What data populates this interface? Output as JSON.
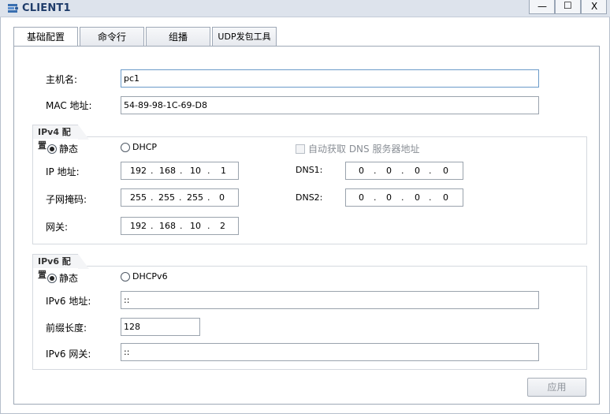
{
  "window": {
    "title": "CLIENT1",
    "min_glyph": "—",
    "max_glyph": "☐",
    "close_glyph": "X"
  },
  "tabs": [
    {
      "label": "基础配置",
      "active": true
    },
    {
      "label": "命令行",
      "active": false
    },
    {
      "label": "组播",
      "active": false
    },
    {
      "label": "UDP发包工具",
      "active": false
    }
  ],
  "basic": {
    "hostname_label": "主机名:",
    "hostname_value": "pc1",
    "mac_label": "MAC 地址:",
    "mac_value": "54-89-98-1C-69-D8"
  },
  "ipv4": {
    "section_title": "IPv4 配置",
    "static_label": "静态",
    "dhcp_label": "DHCP",
    "auto_dns_label": "自动获取 DNS 服务器地址",
    "ip_label": "IP 地址:",
    "ip": [
      "192",
      "168",
      "10",
      "1"
    ],
    "mask_label": "子网掩码:",
    "mask": [
      "255",
      "255",
      "255",
      "0"
    ],
    "gateway_label": "网关:",
    "gateway": [
      "192",
      "168",
      "10",
      "2"
    ],
    "dns1_label": "DNS1:",
    "dns1": [
      "0",
      "0",
      "0",
      "0"
    ],
    "dns2_label": "DNS2:",
    "dns2": [
      "0",
      "0",
      "0",
      "0"
    ]
  },
  "ipv6": {
    "section_title": "IPv6 配置",
    "static_label": "静态",
    "dhcp_label": "DHCPv6",
    "addr_label": "IPv6 地址:",
    "addr_value": "::",
    "prefix_label": "前缀长度:",
    "prefix_value": "128",
    "gateway_label": "IPv6 网关:",
    "gateway_value": "::"
  },
  "apply_label": "应用",
  "ip_dot": "."
}
